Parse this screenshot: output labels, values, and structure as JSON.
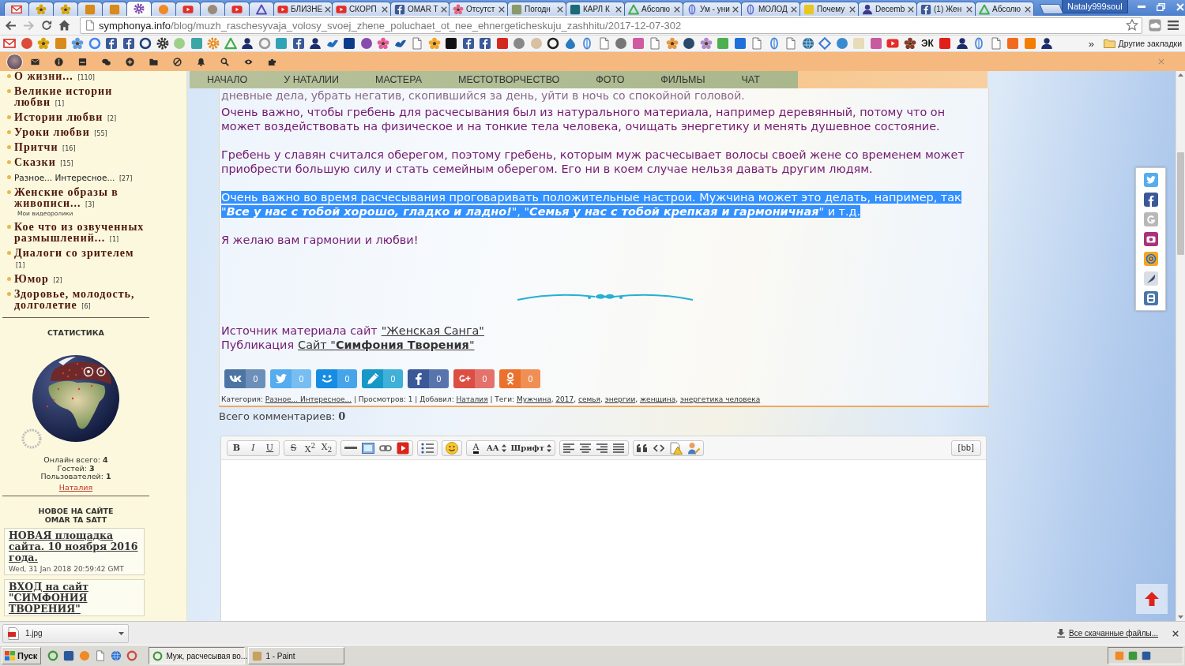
{
  "browser": {
    "tabs": [
      {
        "pinned": true,
        "selected": false
      },
      {
        "pinned": true,
        "selected": false
      },
      {
        "pinned": true,
        "selected": false
      },
      {
        "pinned": true,
        "selected": false
      },
      {
        "pinned": true,
        "selected": false
      },
      {
        "pinned": true,
        "selected": true
      },
      {
        "pinned": true,
        "selected": false
      },
      {
        "pinned": true,
        "selected": false
      },
      {
        "pinned": true,
        "selected": false
      },
      {
        "pinned": true,
        "selected": false
      },
      {
        "pinned": true,
        "selected": false
      },
      {
        "pinned": false,
        "selected": false,
        "title": "БЛИЗНЕ"
      },
      {
        "pinned": false,
        "selected": false,
        "title": "СКОРП"
      },
      {
        "pinned": false,
        "selected": false,
        "title": "OMAR T"
      },
      {
        "pinned": false,
        "selected": false,
        "title": "Отсутст"
      },
      {
        "pinned": false,
        "selected": false,
        "title": "Погодн"
      },
      {
        "pinned": false,
        "selected": false,
        "title": "КАРЛ К"
      },
      {
        "pinned": false,
        "selected": false,
        "title": "Абсолю"
      },
      {
        "pinned": false,
        "selected": false,
        "title": "Ум - уни"
      },
      {
        "pinned": false,
        "selected": false,
        "title": "МОЛОД"
      },
      {
        "pinned": false,
        "selected": false,
        "title": "Почему"
      },
      {
        "pinned": false,
        "selected": false,
        "title": "Decemb"
      },
      {
        "pinned": false,
        "selected": false,
        "title": "(1) Жен"
      },
      {
        "pinned": false,
        "selected": false,
        "title": "Абсолю"
      }
    ],
    "profile": "Nataly999soul",
    "address": {
      "domain": "symphonya.info",
      "path": "/blog/muzh_raschesyvaja_volosy_svoej_zhene_poluchaet_ot_nee_ehnergeticheskuju_zashhitu/2017-12-07-302"
    },
    "bookmarks": {
      "text_item": "ЭК",
      "more": "»",
      "folder": "Другие закладки"
    }
  },
  "sidebar": {
    "categories": [
      {
        "name": "О жизни...",
        "count": "[110]",
        "selected": false
      },
      {
        "name": "Великие истории любви",
        "count": "[1]",
        "selected": false
      },
      {
        "name": "Истории любви",
        "count": "[2]",
        "selected": false
      },
      {
        "name": "Уроки любви",
        "count": "[55]",
        "selected": false
      },
      {
        "name": "Притчи",
        "count": "[16]",
        "selected": false
      },
      {
        "name": "Сказки",
        "count": "[15]",
        "selected": false
      },
      {
        "name": "Разное... Интересное...",
        "count": "[27]",
        "selected": true
      },
      {
        "name": "Женские образы в живописи...",
        "count": "[3]",
        "selected": false,
        "note": "Мои видеоролики"
      },
      {
        "name": "Кое что из озвученных размышлений...",
        "count": "[1]",
        "selected": false
      },
      {
        "name": "Диалоги со зрителем",
        "count": "[1]",
        "selected": false
      },
      {
        "name": "Юмор",
        "count": "[2]",
        "selected": false
      },
      {
        "name": "Здоровье, молодость, долголетие",
        "count": "[6]",
        "selected": false
      }
    ],
    "stats": {
      "title": "СТАТИСТИКА",
      "rows": [
        "Онлайн всего: **4**",
        "Гостей: **3**",
        "Пользователей: **1**"
      ],
      "user": "Наталия"
    },
    "news": {
      "title": "НОВОЕ НА САЙТЕ OMAR TA SATT",
      "items": [
        {
          "title": "НОВАЯ площадка сайта. 10 ноября 2016 года.",
          "date": "Wed, 31 Jan 2018 20:59:42 GMT"
        },
        {
          "title": "ВХОД на сайт \"СИМФОНИЯ ТВОРЕНИЯ\""
        }
      ]
    }
  },
  "site_nav": {
    "items": [
      "НАЧАЛО",
      "У НАТАЛИИ",
      "МАСТЕРА",
      "МЕСТОТВОРЧЕСТВО",
      "ФОТО",
      "ФИЛЬМЫ",
      "ЧАТ"
    ]
  },
  "article": {
    "covered_line": "дневные дела, убрать негатив, скопившийся за день, уйти в ночь со спокойной головой.",
    "paragraphs": [
      {
        "text": "Очень важно, чтобы гребень для расчесывания был из натурального материала, например деревянный, потому что он может воздействовать на физическое и на тонкие тела человека, очищать энергетику и менять душевное состояние.",
        "highlighted": false
      },
      {
        "text": "Гребень у славян считался оберегом, поэтому гребень, которым муж расчесывает волосы своей жене со временем может приобрести большую силу и стать семейным оберегом. Его ни в коем случае нельзя давать другим людям.",
        "highlighted": false
      },
      {
        "text": "Очень важно во время расчесывания проговаривать положительные настрои. Мужчина может это делать, например, так \"**Все у нас с тобой хорошо, гладко и ладно!**\", \"**Семья у нас с тобой крепкая и гармоничная**\" и т.д.",
        "highlighted": true
      },
      {
        "text": "Я желаю вам гармонии и любви!",
        "highlighted": false
      }
    ],
    "sources": [
      {
        "label": "Источник материала сайт",
        "link": "\"Женская Санга\""
      },
      {
        "label": "Публикация",
        "link": "Сайт \"**Симфония Творения**\""
      }
    ],
    "share": [
      {
        "kind": "vk",
        "count": "0"
      },
      {
        "kind": "twitter",
        "count": "0"
      },
      {
        "kind": "moimir",
        "count": "0"
      },
      {
        "kind": "livejournal",
        "count": "0"
      },
      {
        "kind": "facebook",
        "count": "0"
      },
      {
        "kind": "googleplus",
        "count": "0"
      },
      {
        "kind": "odnoklassniki",
        "count": "0"
      }
    ],
    "meta": [
      {
        "kind": "text",
        "text": "Категория: "
      },
      {
        "kind": "link",
        "text": "Разное... Интересное..."
      },
      {
        "kind": "text",
        "text": " | Просмотров: 1 | Добавил: "
      },
      {
        "kind": "link",
        "text": "Наталия"
      },
      {
        "kind": "text",
        "text": " | Теги: "
      },
      {
        "kind": "link",
        "text": "Мужчина"
      },
      {
        "kind": "text",
        "text": ", "
      },
      {
        "kind": "link",
        "text": "2017"
      },
      {
        "kind": "text",
        "text": ", "
      },
      {
        "kind": "link",
        "text": "семья"
      },
      {
        "kind": "text",
        "text": ", "
      },
      {
        "kind": "link",
        "text": "энергии"
      },
      {
        "kind": "text",
        "text": ", "
      },
      {
        "kind": "link",
        "text": "женщина"
      },
      {
        "kind": "text",
        "text": ", "
      },
      {
        "kind": "link",
        "text": "энергетика человека"
      }
    ]
  },
  "comments": {
    "total": "Всего комментариев: **0**"
  },
  "editor": {
    "groups": [
      [
        {
          "kind": "bold",
          "label": "B"
        },
        {
          "kind": "italic",
          "label": "I"
        },
        {
          "kind": "underline",
          "label": "U"
        }
      ],
      [
        {
          "kind": "strike",
          "label": "S"
        },
        {
          "kind": "sup",
          "label": "X$^{2}$"
        },
        {
          "kind": "sub",
          "label": "X$_{2}$"
        }
      ],
      [
        {
          "kind": "rule"
        },
        {
          "kind": "image"
        },
        {
          "kind": "link"
        },
        {
          "kind": "video"
        }
      ],
      [
        {
          "kind": "list"
        }
      ],
      [
        {
          "kind": "smiley"
        }
      ],
      [
        {
          "kind": "color",
          "label": "A"
        },
        {
          "kind": "size",
          "label": "AA"
        },
        {
          "kind": "font",
          "label": "Шрифт"
        }
      ],
      [
        {
          "kind": "align_left"
        },
        {
          "kind": "align_center"
        },
        {
          "kind": "align_right"
        },
        {
          "kind": "justify"
        }
      ],
      [
        {
          "kind": "quote"
        },
        {
          "kind": "code"
        },
        {
          "kind": "warning"
        },
        {
          "kind": "paint"
        }
      ]
    ],
    "mode_button": "[bb]"
  },
  "downloads": {
    "file": "1.jpg",
    "all_link": "Все скачанные файлы..."
  },
  "taskbar": {
    "start": "Пуск",
    "tasks": [
      {
        "title": "Муж, расчесывая во...",
        "selected": true
      },
      {
        "title": "1 - Paint",
        "selected": false
      }
    ]
  }
}
